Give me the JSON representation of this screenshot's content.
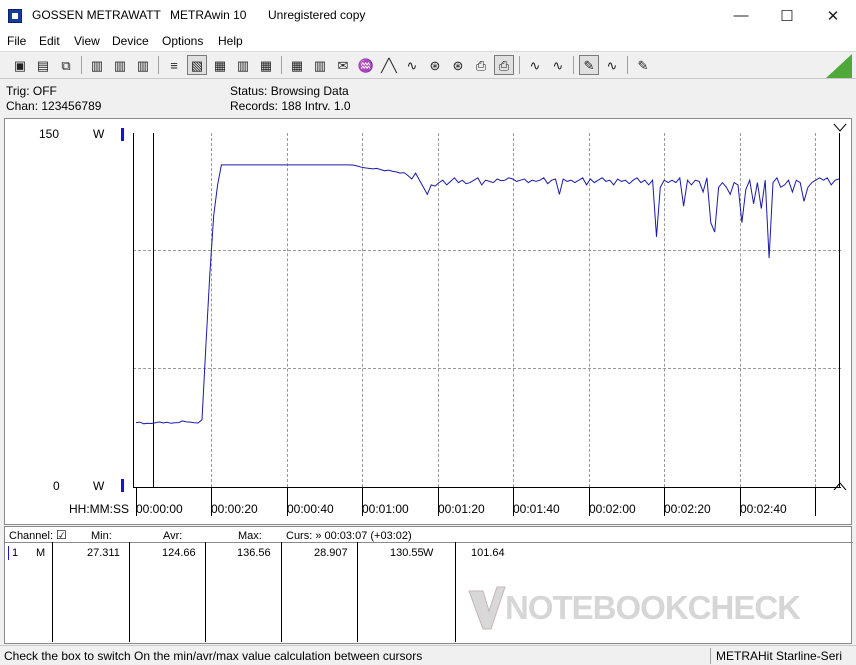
{
  "window": {
    "company": "GOSSEN METRAWATT",
    "app_name": "METRAwin 10",
    "license": "Unregistered copy",
    "minimize_glyph": "—",
    "maximize_glyph": "☐",
    "close_glyph": "✕"
  },
  "menu": [
    "File",
    "Edit",
    "View",
    "Device",
    "Options",
    "Help"
  ],
  "toolbar": {
    "glyphs": [
      "▣",
      "▤",
      "⧉",
      "▥",
      "▥",
      "▥",
      "≡",
      "▧",
      "▦",
      "▥",
      "▦",
      "▦",
      "▥",
      "✉",
      "♒",
      "╱╲",
      "∿",
      "⊛",
      "⊛",
      "⎙",
      "⎙",
      "∿",
      "∿",
      "✎"
    ]
  },
  "info": {
    "trig": "Trig: OFF",
    "chan": "Chan:  123456789",
    "status": "Status:    Browsing Data",
    "records": "Records: 188  Intrv. 1.0"
  },
  "plot": {
    "y_top_value": "150",
    "y_bottom_value": "0",
    "y_unit_top": "W",
    "y_unit_bottom": "W",
    "x_label": "HH:MM:SS",
    "x_ticks": [
      "00:00:00",
      "00:00:20",
      "00:00:40",
      "00:01:00",
      "00:01:20",
      "00:01:40",
      "00:02:00",
      "00:02:20",
      "00:02:40"
    ],
    "line_color": "#1a1aa8",
    "power_series": [
      27.3,
      27.5,
      26.8,
      27.0,
      26.9,
      27.2,
      27.6,
      27.1,
      27.4,
      27.0,
      27.2,
      27.3,
      28.0,
      27.6,
      27.5,
      27.2,
      27.1,
      28.5,
      60,
      90,
      115,
      128,
      136.5,
      136.5,
      136.5,
      136.5,
      136.5,
      136.5,
      136.5,
      136.5,
      136.5,
      136.5,
      136.5,
      136.5,
      136.5,
      136.5,
      136.5,
      136.5,
      136.5,
      136.5,
      136.5,
      136.5,
      136.5,
      136.5,
      136.5,
      136.5,
      136.5,
      136.5,
      136.5,
      136.5,
      136.5,
      136.5,
      136.5,
      136.5,
      136.5,
      136.5,
      136.4,
      136.0,
      135.5,
      135.2,
      135.0,
      134.8,
      135.0,
      134.5,
      134.0,
      134.3,
      133.8,
      133.5,
      133.0,
      133.2,
      132.0,
      130.5,
      133.0,
      130.0,
      127.0,
      124.0,
      128.0,
      127.5,
      129.0,
      130.0,
      128.0,
      129.5,
      131.0,
      129.0,
      130.0,
      128.5,
      129.0,
      130.0,
      131.0,
      128.0,
      130.0,
      129.5,
      129.0,
      130.5,
      129.8,
      130.0,
      131.0,
      130.5,
      129.5,
      130.0,
      130.5,
      129.0,
      130.0,
      129.5,
      130.0,
      131.0,
      128.5,
      130.0,
      130.5,
      124.0,
      130.5,
      129.5,
      130.0,
      129.0,
      130.0,
      131.0,
      128.0,
      130.5,
      129.0,
      130.0,
      131.0,
      129.5,
      130.0,
      128.0,
      130.5,
      129.5,
      130.0,
      128.5,
      130.0,
      131.0,
      129.0,
      130.0,
      128.0,
      130.0,
      106.0,
      127.0,
      130.0,
      129.0,
      130.0,
      129.0,
      131.0,
      119.0,
      130.0,
      128.0,
      130.0,
      129.5,
      125.0,
      131.0,
      112.0,
      108.0,
      127.0,
      129.0,
      127.0,
      124.0,
      129.0,
      128.0,
      112.0,
      126.0,
      130.0,
      120.0,
      129.0,
      118.0,
      130.0,
      97.0,
      129.0,
      131.0,
      127.0,
      128.0,
      130.0,
      125.0,
      130.0,
      129.0,
      121.0,
      127.0,
      129.0,
      130.0,
      131.0,
      130.0,
      131.0,
      128.0,
      130.0,
      130.5
    ],
    "y_min": 0,
    "y_max": 150,
    "x_min_seconds": 0,
    "x_max_seconds": 187,
    "x_offset_seconds": -8
  },
  "table": {
    "headers": {
      "channel": "Channel:",
      "check": "☑",
      "min": "Min:",
      "avr": "Avr:",
      "max": "Max:",
      "curs": "Curs: » 00:03:07 (+03:02)"
    },
    "row": {
      "index": "1",
      "mode": "M",
      "min": "27.311",
      "avr": "124.66",
      "max": "136.56",
      "cursor_min": "28.907",
      "cursor_value": "130.55",
      "unit": "W",
      "extra": "101.64"
    },
    "watermark": "NOTEBOOKCHECK"
  },
  "status": {
    "hint": "Check the box to switch On the min/avr/max value calculation between cursors",
    "device": "METRAHit Starline-Seri"
  }
}
